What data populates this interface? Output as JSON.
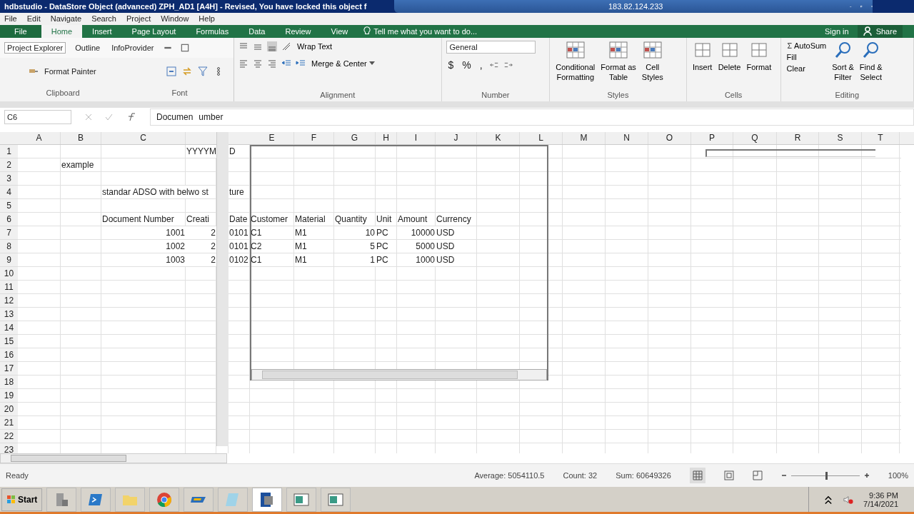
{
  "title_bar": {
    "title": "hdbstudio - DataStore Object (advanced) ZPH_AD1 [A4H] - Revised, You have locked this object f",
    "remote_host": "183.82.124.233"
  },
  "menu": [
    "File",
    "Edit",
    "Navigate",
    "Search",
    "Project",
    "Window",
    "Help"
  ],
  "ribbon_tabs": [
    {
      "label": "File",
      "selected": false,
      "kind": "backstage"
    },
    {
      "label": "Home",
      "selected": true,
      "kind": "tab"
    },
    {
      "label": "Insert",
      "selected": false,
      "kind": "tab"
    },
    {
      "label": "Page Layout",
      "selected": false,
      "kind": "tab"
    },
    {
      "label": "Formulas",
      "selected": false,
      "kind": "tab"
    },
    {
      "label": "Data",
      "selected": false,
      "kind": "tab"
    },
    {
      "label": "Review",
      "selected": false,
      "kind": "tab"
    },
    {
      "label": "View",
      "selected": false,
      "kind": "tab"
    }
  ],
  "tell_me": "Tell me what you want to do...",
  "sign_in": "Sign in",
  "share": "Share",
  "view_tabs": [
    {
      "label": "Project Explorer",
      "selected": true
    },
    {
      "label": "Outline",
      "selected": false
    },
    {
      "label": "InfoProvider",
      "selected": false
    }
  ],
  "clipboard": {
    "format_painter": "Format Painter",
    "label": "Clipboard"
  },
  "font": {
    "label": "Font"
  },
  "alignment": {
    "wrap_text": "Wrap Text",
    "merge": "Merge & Center",
    "label": "Alignment"
  },
  "number": {
    "format": "General",
    "currency": "$",
    "percent": "%",
    "comma": ",",
    "label": "Number"
  },
  "styles": {
    "buttons": [
      {
        "lines": [
          "Conditional",
          "Formatting"
        ]
      },
      {
        "lines": [
          "Format as",
          "Table"
        ]
      },
      {
        "lines": [
          "Cell",
          "Styles"
        ]
      }
    ],
    "label": "Styles"
  },
  "cells_group": {
    "buttons": [
      "Insert",
      "Delete",
      "Format"
    ],
    "label": "Cells"
  },
  "editing": {
    "autosum": "AutoSum",
    "fill": "Fill",
    "clear": "Clear",
    "buttons": [
      {
        "lines": [
          "Sort &",
          "Filter"
        ]
      },
      {
        "lines": [
          "Find &",
          "Select"
        ]
      }
    ],
    "label": "Editing"
  },
  "formula_bar": {
    "name_box": "C6",
    "value_left": "Documen",
    "value_right": "umber"
  },
  "columns": [
    "A",
    "B",
    "C",
    "E",
    "F",
    "G",
    "H",
    "I",
    "J",
    "K",
    "L",
    "M",
    "N",
    "O",
    "P",
    "Q",
    "R",
    "S",
    "T"
  ],
  "rows": [
    {
      "number": "1",
      "cells": {
        "D": {
          "text": "YYYYM",
          "kind": "text"
        },
        "D_cont": {
          "text": "D",
          "kind": "text"
        }
      }
    },
    {
      "number": "2",
      "cells": {
        "B": {
          "text": "example",
          "kind": "text"
        }
      }
    },
    {
      "number": "3",
      "cells": {}
    },
    {
      "number": "4",
      "cells": {
        "C": {
          "text": "standar ADSO with belwo st",
          "kind": "text"
        },
        "D_cont": {
          "text": "ture",
          "kind": "text"
        }
      }
    },
    {
      "number": "5",
      "cells": {}
    },
    {
      "number": "6",
      "cells": {
        "C": {
          "text": "Document Number",
          "kind": "text"
        },
        "D": {
          "text": "Creati",
          "kind": "text"
        },
        "D_cont": {
          "text": "Date",
          "kind": "text"
        },
        "E": {
          "text": "Customer",
          "kind": "text"
        },
        "F": {
          "text": "Material",
          "kind": "text"
        },
        "G": {
          "text": "Quantity",
          "kind": "text"
        },
        "H": {
          "text": "Unit",
          "kind": "text"
        },
        "I": {
          "text": "Amount",
          "kind": "text"
        },
        "J": {
          "text": "Currency",
          "kind": "text"
        }
      }
    },
    {
      "number": "7",
      "cells": {
        "C": {
          "text": "1001",
          "kind": "number"
        },
        "D": {
          "text": "2",
          "kind": "number"
        },
        "D_cont": {
          "text": "0101",
          "kind": "text"
        },
        "E": {
          "text": "C1",
          "kind": "text"
        },
        "F": {
          "text": "M1",
          "kind": "text"
        },
        "G": {
          "text": "10",
          "kind": "number"
        },
        "H": {
          "text": "PC",
          "kind": "text"
        },
        "I": {
          "text": "10000",
          "kind": "number"
        },
        "J": {
          "text": "USD",
          "kind": "text"
        }
      }
    },
    {
      "number": "8",
      "cells": {
        "C": {
          "text": "1002",
          "kind": "number"
        },
        "D": {
          "text": "2",
          "kind": "number"
        },
        "D_cont": {
          "text": "0101",
          "kind": "text"
        },
        "E": {
          "text": "C2",
          "kind": "text"
        },
        "F": {
          "text": "M1",
          "kind": "text"
        },
        "G": {
          "text": "5",
          "kind": "number"
        },
        "H": {
          "text": "PC",
          "kind": "text"
        },
        "I": {
          "text": "5000",
          "kind": "number"
        },
        "J": {
          "text": "USD",
          "kind": "text"
        }
      }
    },
    {
      "number": "9",
      "cells": {
        "C": {
          "text": "1003",
          "kind": "number"
        },
        "D": {
          "text": "2",
          "kind": "number"
        },
        "D_cont": {
          "text": "0102",
          "kind": "text"
        },
        "E": {
          "text": "C1",
          "kind": "text"
        },
        "F": {
          "text": "M1",
          "kind": "text"
        },
        "G": {
          "text": "1",
          "kind": "number"
        },
        "H": {
          "text": "PC",
          "kind": "text"
        },
        "I": {
          "text": "1000",
          "kind": "number"
        },
        "J": {
          "text": "USD",
          "kind": "text"
        }
      }
    },
    {
      "number": "10",
      "cells": {}
    },
    {
      "number": "11",
      "cells": {}
    },
    {
      "number": "12",
      "cells": {}
    },
    {
      "number": "13",
      "cells": {}
    },
    {
      "number": "14",
      "cells": {}
    },
    {
      "number": "15",
      "cells": {}
    },
    {
      "number": "16",
      "cells": {}
    },
    {
      "number": "17",
      "cells": {}
    },
    {
      "number": "18",
      "cells": {}
    },
    {
      "number": "19",
      "cells": {}
    },
    {
      "number": "20",
      "cells": {}
    },
    {
      "number": "21",
      "cells": {}
    },
    {
      "number": "22",
      "cells": {}
    },
    {
      "number": "23",
      "cells": {}
    }
  ],
  "status": {
    "text": "Ready",
    "average": "Average: 5054110.5",
    "count": "Count: 32",
    "sum": "Sum: 60649326",
    "zoom": "100%",
    "level": 0.5
  },
  "taskbar": {
    "start": "Start",
    "time": "9:36 PM",
    "date": "7/14/2021"
  }
}
